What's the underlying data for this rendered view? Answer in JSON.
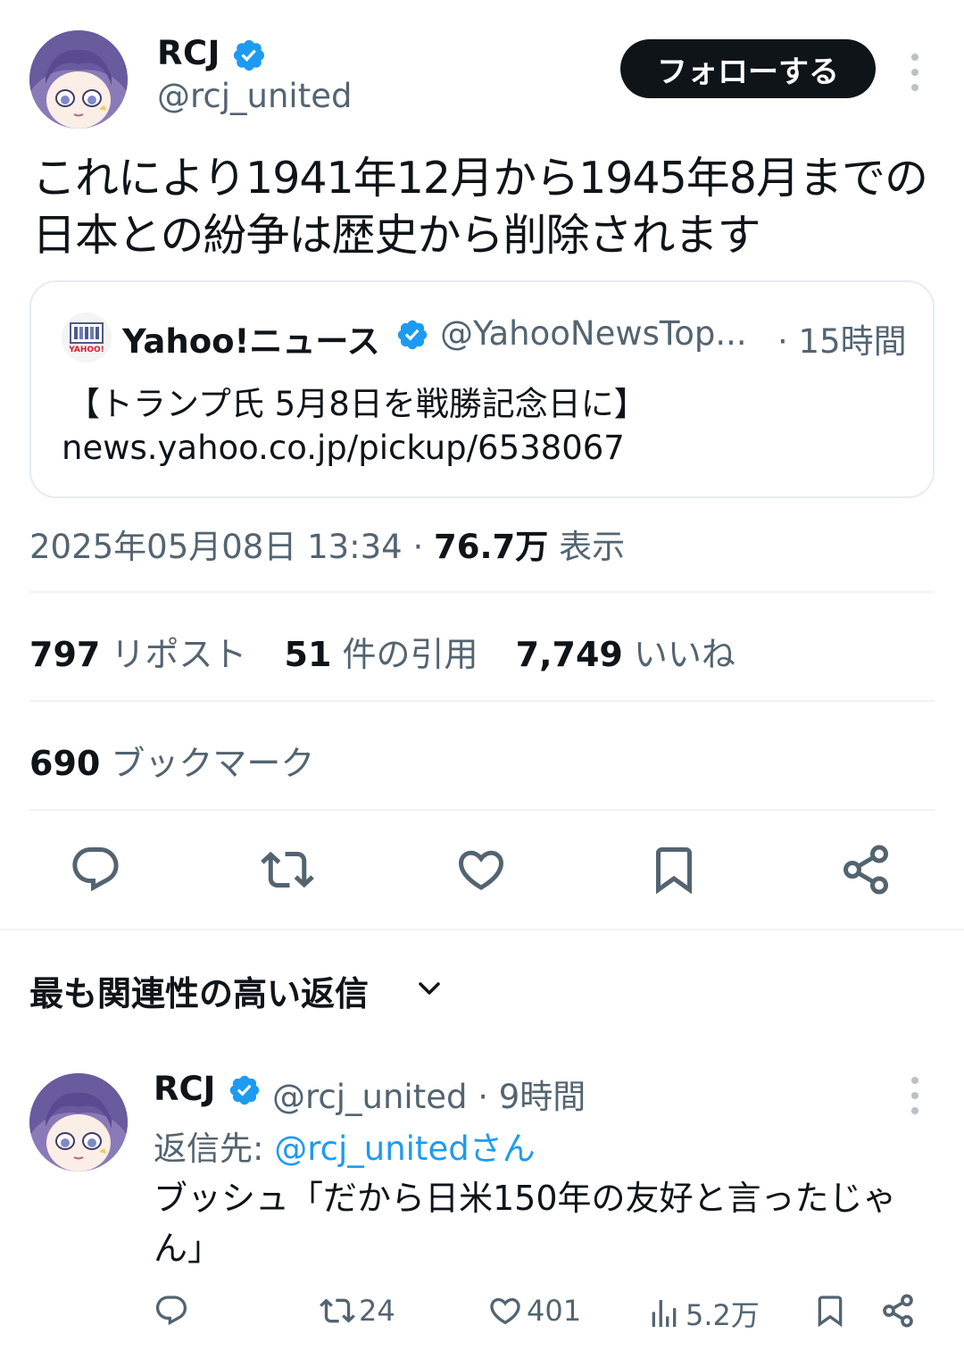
{
  "tweet": {
    "author": {
      "name": "RCJ",
      "handle": "@rcj_united"
    },
    "follow_label": "フォローする",
    "text": "これにより1941年12月から1945年8月までの日本との紛争は歴史から削除されます",
    "quote": {
      "source_name": "Yahoo!ニュース",
      "source_handle": "@YahooNewsTop...",
      "time": "· 15時間",
      "headline": "【トランプ氏 5月8日を戦勝記念日に】",
      "url": "news.yahoo.co.jp/pickup/6538067",
      "logo_text": "YAHOO!"
    },
    "timestamp": "2025年05月08日 13:34",
    "separator": "·",
    "views_count": "76.7万",
    "views_label": "表示",
    "stats": {
      "reposts_count": "797",
      "reposts_label": "リポスト",
      "quotes_count": "51",
      "quotes_label": "件の引用",
      "likes_count": "7,749",
      "likes_label": "いいね",
      "bookmarks_count": "690",
      "bookmarks_label": "ブックマーク"
    }
  },
  "replies_section": {
    "sort_label": "最も関連性の高い返信"
  },
  "reply": {
    "author": {
      "name": "RCJ",
      "handle": "@rcj_united"
    },
    "time": "· 9時間",
    "reply_to_prefix": "返信先:",
    "reply_to_handle": "@rcj_unitedさん",
    "text": "ブッシュ「だから日米150年の友好と言ったじゃん」",
    "counts": {
      "reposts": "24",
      "likes": "401",
      "views": "5.2万"
    }
  },
  "colors": {
    "text": "#0f1419",
    "secondary": "#536471",
    "accent": "#1d9bf0",
    "border": "#eff3f4"
  },
  "icons": [
    "verified-badge-icon",
    "more-icon",
    "reply-icon",
    "repost-icon",
    "like-icon",
    "bookmark-icon",
    "share-icon",
    "views-icon",
    "chevron-down-icon"
  ]
}
